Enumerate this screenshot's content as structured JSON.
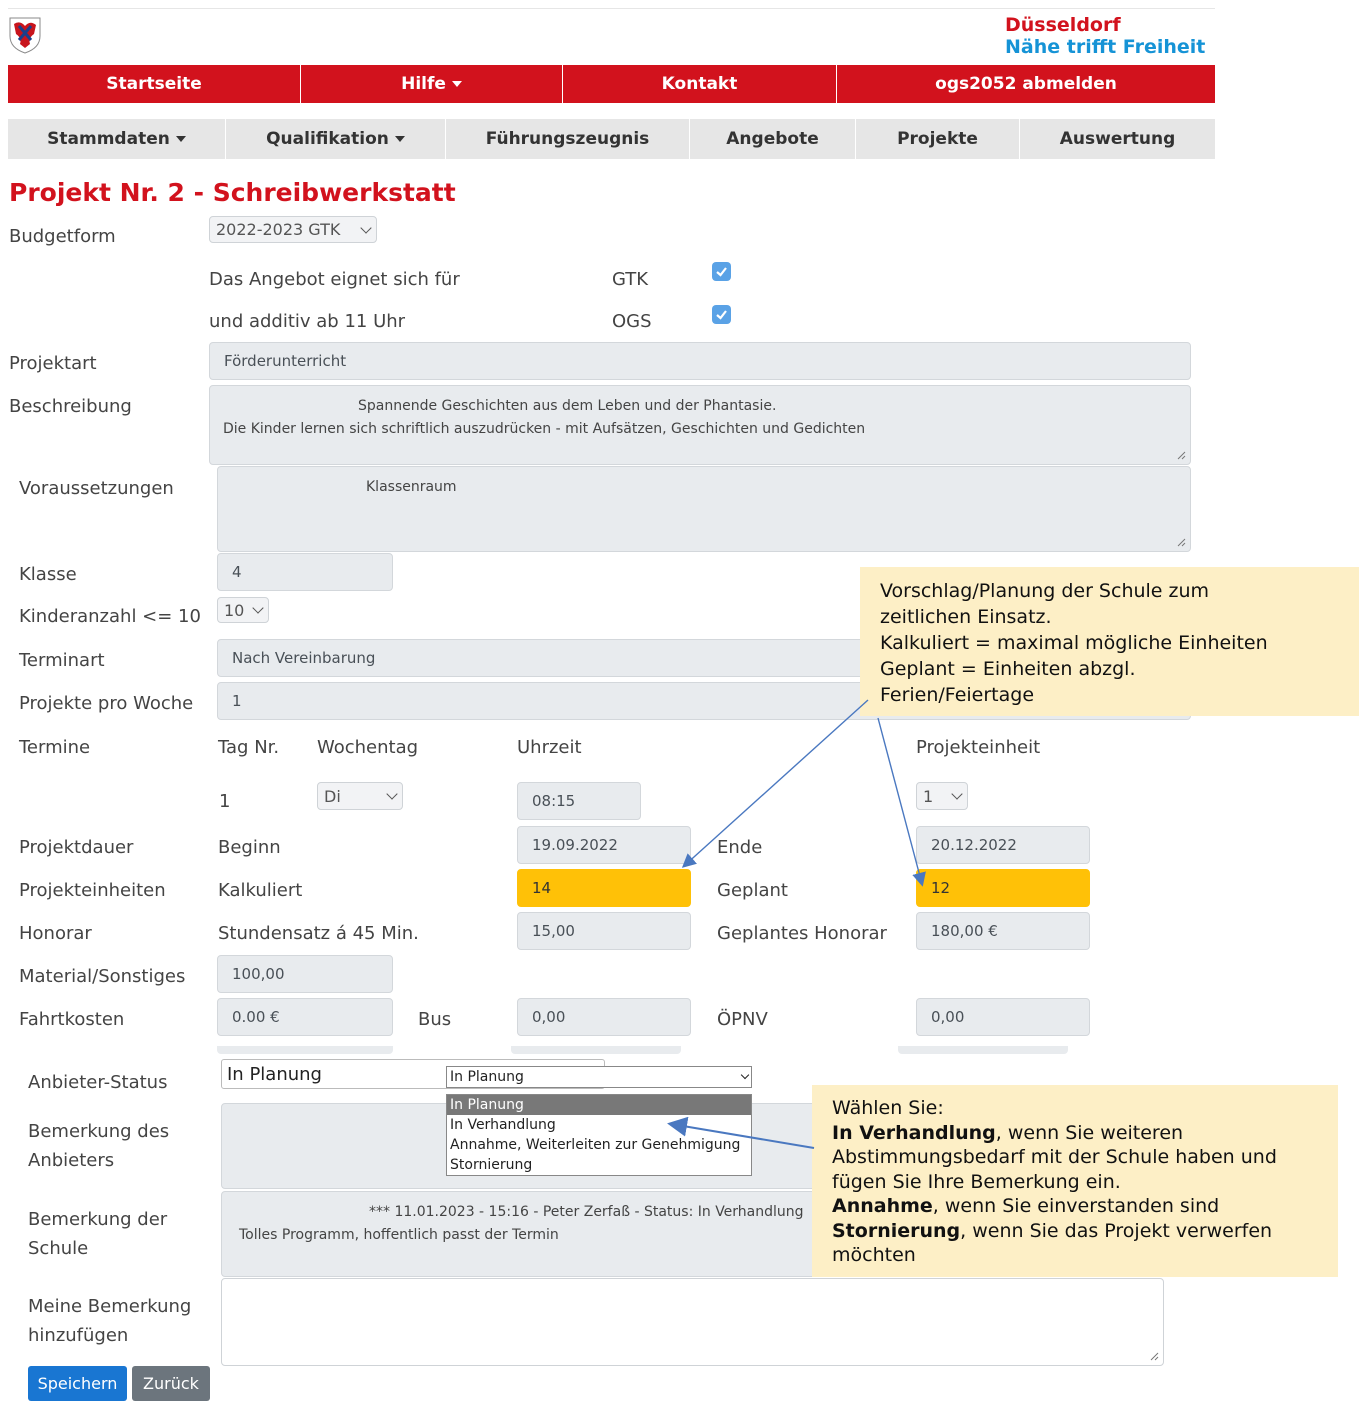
{
  "header": {
    "brand_line1": "Düsseldorf",
    "brand_line2": "Nähe trifft Freiheit"
  },
  "nav_main": [
    "Startseite",
    "Hilfe",
    "Kontakt",
    "ogs2052 abmelden"
  ],
  "nav_sub": [
    "Stammdaten",
    "Qualifikation",
    "Führungszeugnis",
    "Angebote",
    "Projekte",
    "Auswertung"
  ],
  "page_title": "Projekt Nr. 2 - Schreibwerkstatt",
  "form": {
    "budgetform_label": "Budgetform",
    "budgetform_value": "2022-2023 GTK",
    "angebot_label": "Das Angebot eignet sich für",
    "gtk_label": "GTK",
    "additiv_label": "und additiv ab 11 Uhr",
    "ogs_label": "OGS",
    "projektart_label": "Projektart",
    "projektart_value": "Förderunterricht",
    "beschreibung_label": "Beschreibung",
    "beschreibung_line1": "Spannende Geschichten aus dem Leben und der Phantasie.",
    "beschreibung_line2": "Die Kinder lernen sich schriftlich auszudrücken - mit Aufsätzen, Geschichten und Gedichten",
    "voraussetzungen_label": "Voraussetzungen",
    "voraussetzungen_value": "Klassenraum",
    "klasse_label": "Klasse",
    "klasse_value": "4",
    "kinderanzahl_label": "Kinderanzahl <= 10",
    "kinderanzahl_value": "10",
    "terminart_label": "Terminart",
    "terminart_value": "Nach Vereinbarung",
    "projekte_woche_label": "Projekte pro Woche",
    "projekte_woche_value": "1",
    "termine_label": "Termine",
    "col_tag": "Tag Nr.",
    "col_wochentag": "Wochentag",
    "col_uhrzeit": "Uhrzeit",
    "col_projekteinheit": "Projekteinheit",
    "tag_nr": "1",
    "wochentag_value": "Di",
    "uhrzeit_value": "08:15",
    "projekteinheit_value": "1",
    "projektdauer_label": "Projektdauer",
    "beginn_label": "Beginn",
    "beginn_value": "19.09.2022",
    "ende_label": "Ende",
    "ende_value": "20.12.2022",
    "projekteinheiten_label": "Projekteinheiten",
    "kalkuliert_label": "Kalkuliert",
    "kalkuliert_value": "14",
    "geplant_label": "Geplant",
    "geplant_value": "12",
    "honorar_label": "Honorar",
    "stundensatz_label": "Stundensatz á 45 Min.",
    "stundensatz_value": "15,00",
    "geplantes_honorar_label": "Geplantes Honorar",
    "geplantes_honorar_value": "180,00 €",
    "material_label": "Material/Sonstiges",
    "material_value": "100,00",
    "fahrtkosten_label": "Fahrtkosten",
    "fahrtkosten_value": "0.00 €",
    "bus_label": "Bus",
    "bus_value": "0,00",
    "oepnv_label": "ÖPNV",
    "oepnv_value": "0,00",
    "anbieter_status_label": "Anbieter-Status",
    "anbieter_status_value": "In Planung",
    "status_select_value": "In Planung",
    "status_options": [
      "In Planung",
      "In Verhandlung",
      "Annahme, Weiterleiten zur Genehmigung",
      "Stornierung"
    ],
    "bemerkung_anbieter_label": [
      "Bemerkung des",
      "Anbieters"
    ],
    "bemerkung_schule_label": [
      "Bemerkung der",
      "Schule"
    ],
    "bemerkung_schule_line1": "*** 11.01.2023 - 15:16 - Peter Zerfaß  - Status: In Verhandlung",
    "bemerkung_schule_line2": "Tolles Programm, hoffentlich passt der Termin",
    "meine_bemerkung_label": [
      "Meine Bemerkung",
      "hinzufügen"
    ],
    "save_button": "Speichern",
    "back_button": "Zurück"
  },
  "note1": {
    "lines": [
      "Vorschlag/Planung der Schule zum",
      "zeitlichen Einsatz.",
      "Kalkuliert = maximal mögliche Einheiten",
      "Geplant = Einheiten abzgl.",
      "Ferien/Feiertage"
    ]
  },
  "note2": {
    "line1": "Wählen Sie:",
    "b1": "In Verhandlung",
    "t1": ", wenn Sie weiteren",
    "line3": "Abstimmungsbedarf mit der Schule haben und",
    "line4": "fügen Sie Ihre Bemerkung ein.",
    "b2": "Annahme",
    "t2": ", wenn Sie einverstanden sind",
    "b3": "Stornierung",
    "t3": ", wenn Sie das Projekt verwerfen",
    "line7": "möchten"
  },
  "colors": {
    "brand_red": "#d2121d",
    "brand_blue": "#1593d6",
    "highlight": "#ffc107",
    "note_bg": "#fdefc6",
    "arrow": "#4a78c0"
  }
}
